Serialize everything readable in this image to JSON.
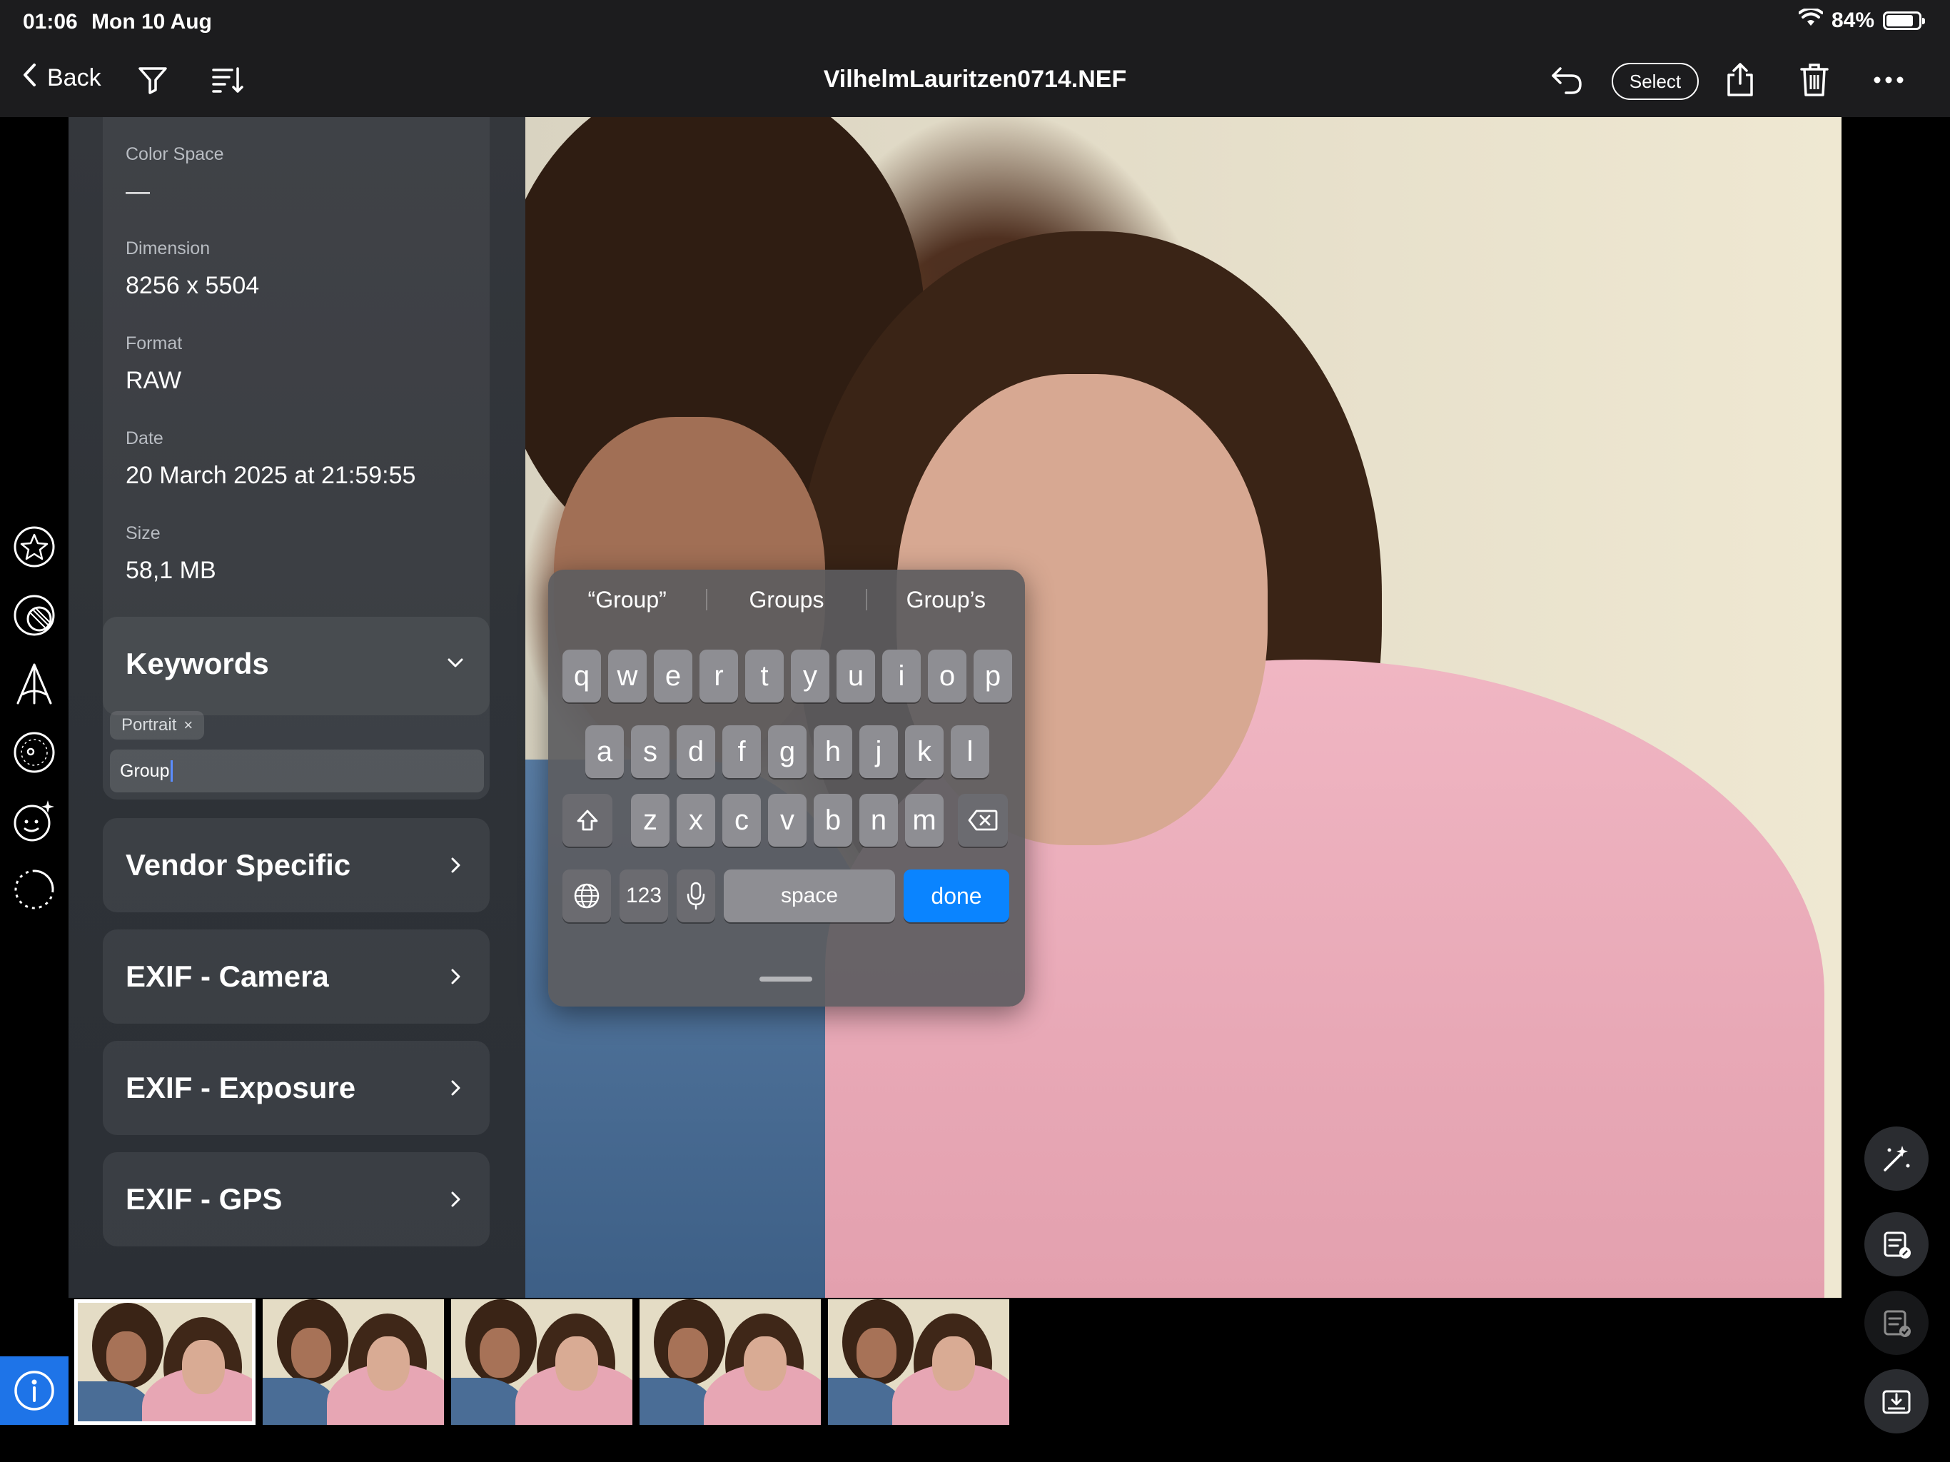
{
  "status_bar": {
    "time": "01:06",
    "date": "Mon 10 Aug",
    "battery_percent": "84%",
    "battery_level": 0.84
  },
  "toolbar": {
    "back_label": "Back",
    "title": "VilhelmLauritzen0714.NEF",
    "select_label": "Select"
  },
  "metadata": {
    "color_space_label": "Color Space",
    "color_space_value": "—",
    "dimension_label": "Dimension",
    "dimension_value": "8256 x 5504",
    "format_label": "Format",
    "format_value": "RAW",
    "date_label": "Date",
    "date_value": "20 March 2025 at 21:59:55",
    "size_label": "Size",
    "size_value": "58,1 MB"
  },
  "keywords": {
    "title": "Keywords",
    "chips": [
      "Portrait"
    ],
    "input_value": "Group"
  },
  "sections": [
    {
      "title": "Vendor Specific"
    },
    {
      "title": "EXIF - Camera"
    },
    {
      "title": "EXIF - Exposure"
    },
    {
      "title": "EXIF - GPS"
    }
  ],
  "keyboard": {
    "suggestions": [
      "“Group”",
      "Groups",
      "Group’s"
    ],
    "row1": [
      "q",
      "w",
      "e",
      "r",
      "t",
      "y",
      "u",
      "i",
      "o",
      "p"
    ],
    "row2": [
      "a",
      "s",
      "d",
      "f",
      "g",
      "h",
      "j",
      "k",
      "l"
    ],
    "row3": [
      "z",
      "x",
      "c",
      "v",
      "b",
      "n",
      "m"
    ],
    "numbers_label": "123",
    "space_label": "space",
    "done_label": "done"
  },
  "filmstrip": {
    "count": 5,
    "selected_index": 0
  },
  "colors": {
    "accent": "#0a84ff",
    "info_button": "#1e74e8",
    "panel": "#2f3338",
    "bar": "#1c1c1e"
  }
}
